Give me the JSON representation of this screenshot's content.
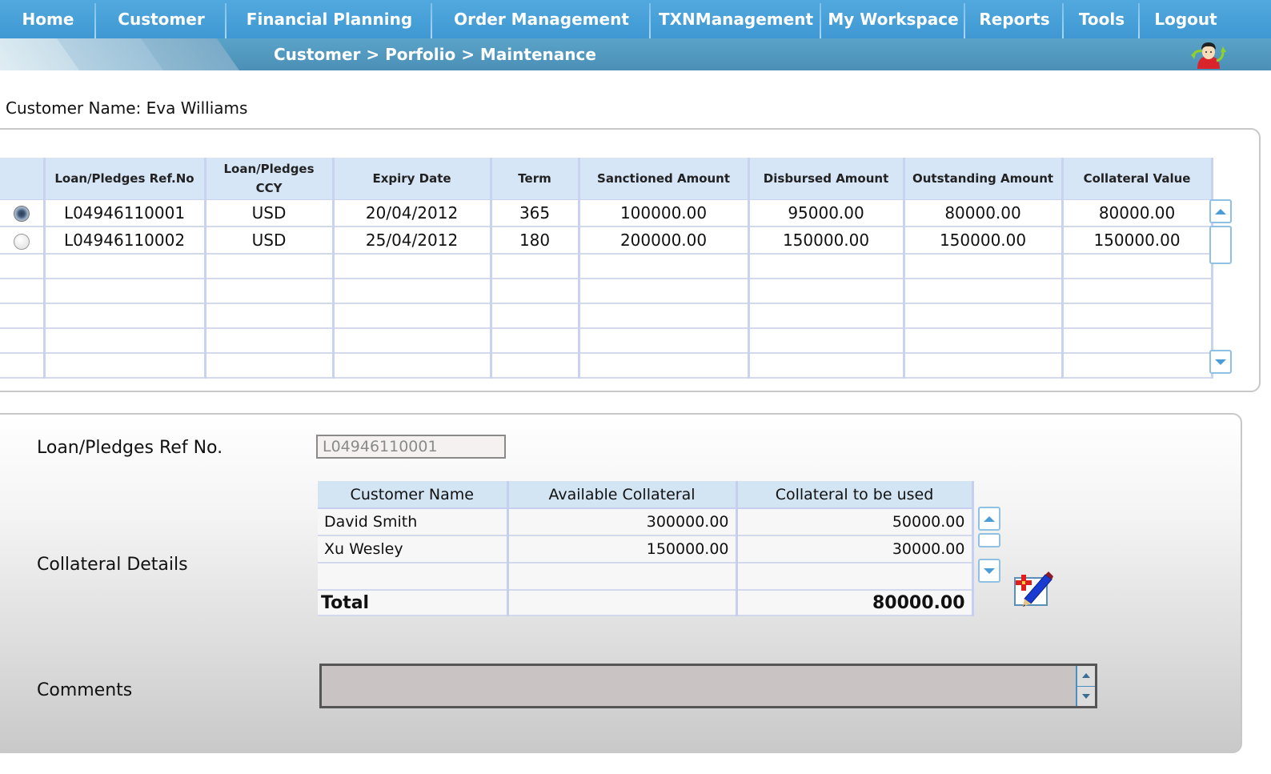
{
  "nav": {
    "items": [
      {
        "label": "Home"
      },
      {
        "label": "Customer"
      },
      {
        "label": "Financial Planning"
      },
      {
        "label": "Order Management"
      },
      {
        "label": "TXNManagement"
      },
      {
        "label": "My Workspace"
      },
      {
        "label": "Reports"
      },
      {
        "label": "Tools"
      },
      {
        "label": "Logout"
      }
    ],
    "breadcrumb": "Customer > Porfolio > Maintenance",
    "avatar_icon": "user-switch-icon"
  },
  "customer": {
    "label": "Customer Name: Eva Williams"
  },
  "loans": {
    "headers": [
      "",
      "Loan/Pledges Ref.No",
      "Loan/Pledges CCY",
      "Expiry Date",
      "Term",
      "Sanctioned Amount",
      "Disbursed Amount",
      "Outstanding Amount",
      "Collateral Value"
    ],
    "rows": [
      {
        "selected": true,
        "ref": "L04946110001",
        "ccy": "USD",
        "expiry": "20/04/2012",
        "term": "365",
        "sanctioned": "100000.00",
        "disbursed": "95000.00",
        "outstanding": "80000.00",
        "collateral": "80000.00"
      },
      {
        "selected": false,
        "ref": "L04946110002",
        "ccy": "USD",
        "expiry": "25/04/2012",
        "term": "180",
        "sanctioned": "200000.00",
        "disbursed": "150000.00",
        "outstanding": "150000.00",
        "collateral": "150000.00"
      }
    ]
  },
  "details": {
    "ref_label": "Loan/Pledges Ref No.",
    "ref_value": "L04946110001",
    "collateral_label": "Collateral Details",
    "collateral_headers": [
      "Customer Name",
      "Available Collateral",
      "Collateral to be used"
    ],
    "collateral_rows": [
      {
        "name": "David Smith",
        "available": "300000.00",
        "used": "50000.00"
      },
      {
        "name": "Xu Wesley",
        "available": "150000.00",
        "used": "30000.00"
      }
    ],
    "total_label": "Total",
    "total_value": "80000.00",
    "comments_label": "Comments",
    "comments_value": ""
  },
  "colors": {
    "nav_blue": "#4aa3dc",
    "header_blue": "#d6e6f6",
    "scroll_accent": "#4a9ed5"
  }
}
